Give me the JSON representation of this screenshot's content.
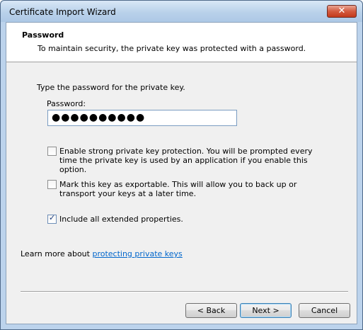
{
  "window": {
    "title": "Certificate Import Wizard"
  },
  "header": {
    "title": "Password",
    "description": "To maintain security, the private key was protected with a password."
  },
  "form": {
    "prompt": "Type the password for the private key.",
    "password_label": "Password:",
    "password_value": "●●●●●●●●●●"
  },
  "options": [
    {
      "label": "Enable strong private key protection. You will be prompted every time the private key is used by an application if you enable this option.",
      "checked": false
    },
    {
      "label": "Mark this key as exportable. This will allow you to back up or transport your keys at a later time.",
      "checked": false
    },
    {
      "label": "Include all extended properties.",
      "checked": true
    }
  ],
  "learn_more": {
    "prefix": "Learn more about ",
    "link": "protecting private keys"
  },
  "buttons": {
    "back": "< Back",
    "next": "Next >",
    "cancel": "Cancel"
  },
  "icons": {
    "close": "close-icon",
    "check": "checkmark-icon"
  },
  "colors": {
    "link": "#0066cc",
    "close_button": "#c33a1c"
  }
}
